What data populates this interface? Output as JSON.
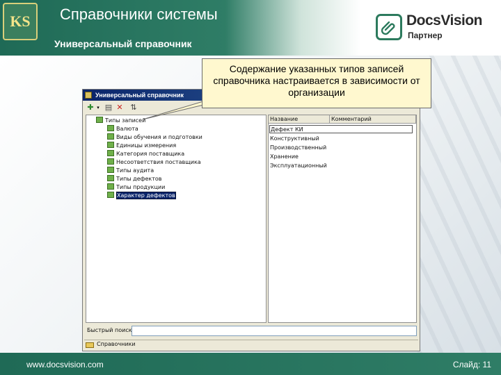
{
  "slide": {
    "title": "Справочники системы",
    "subtitle": "Универсальный справочник",
    "footer_url": "www.docsvision.com",
    "slide_label": "Слайд: 11"
  },
  "brand": {
    "name": "DocsVision",
    "tagline": "Партнер",
    "accent_color": "#2c7a5d"
  },
  "callout": {
    "text": "Содержание указанных типов записей справочника настраивается в зависимости от организации"
  },
  "window": {
    "title": "Универсальный справочник",
    "toolbar": [
      "add-icon",
      "dropdown-icon",
      "properties-icon",
      "delete-icon",
      "refresh-icon"
    ],
    "tree": {
      "root": "Типы записей",
      "items": [
        "Валюта",
        "Виды обучения и подготовки",
        "Единицы измерения",
        "Категория поставщика",
        "Несоответствия поставщика",
        "Типы аудита",
        "Типы дефектов",
        "Типы продукции",
        "Характер дефектов"
      ],
      "selected": "Характер дефектов"
    },
    "list": {
      "columns": [
        "Название",
        "Комментарий"
      ],
      "rows": [
        "Дефект КИ",
        "Конструктивный",
        "Производственный",
        "Хранение",
        "Эксплуатационный"
      ]
    },
    "search_label": "Быстрый поиск:",
    "search_value": "",
    "status": "Справочники"
  }
}
